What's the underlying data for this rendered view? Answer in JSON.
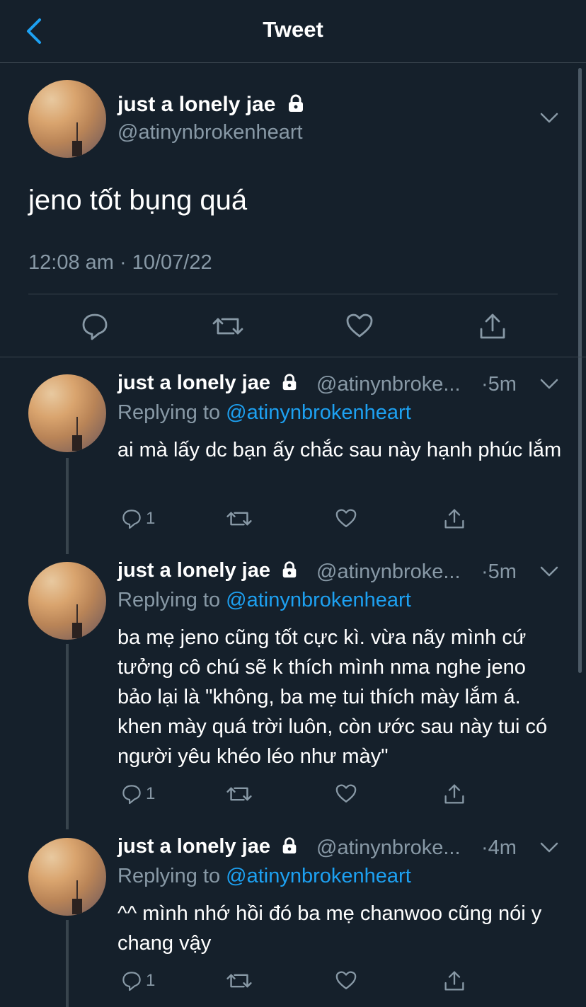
{
  "header": {
    "title": "Tweet",
    "back_icon": "chevron-left-icon"
  },
  "main_tweet": {
    "display_name": "just a lonely jae",
    "handle": "@atinynbrokenheart",
    "text": "jeno tốt bụng quá",
    "timestamp": "12:08 am · 10/07/22",
    "actions": [
      "reply-icon",
      "retweet-icon",
      "like-icon",
      "share-icon"
    ]
  },
  "replies": [
    {
      "display_name": "just a lonely jae",
      "handle": "@atinynbroke...",
      "time": "·5m",
      "replying_prefix": "Replying to ",
      "replying_to": "@atinynbrokenheart",
      "text": "ai mà lấy dc bạn ấy chắc sau này hạnh phúc lắm",
      "reply_count": "1"
    },
    {
      "display_name": "just a lonely jae",
      "handle": "@atinynbroke...",
      "time": "·5m",
      "replying_prefix": "Replying to ",
      "replying_to": "@atinynbrokenheart",
      "text": "ba mẹ jeno cũng tốt cực kì. vừa nãy mình cứ tưởng cô chú sẽ k thích mình nma nghe jeno bảo lại là \"không, ba mẹ tui thích mày lắm á. khen mày quá trời luôn, còn ước sau này tui có người yêu khéo léo như mày\"",
      "reply_count": "1"
    },
    {
      "display_name": "just a lonely jae",
      "handle": "@atinynbroke...",
      "time": "·4m",
      "replying_prefix": "Replying to ",
      "replying_to": "@atinynbrokenheart",
      "text": "^^ mình nhớ hồi đó ba mẹ chanwoo cũng nói y chang vậy",
      "reply_count": "1"
    }
  ],
  "colors": {
    "background": "#15202b",
    "border": "#38444d",
    "secondary_text": "#8899a6",
    "accent": "#1da1f2"
  }
}
